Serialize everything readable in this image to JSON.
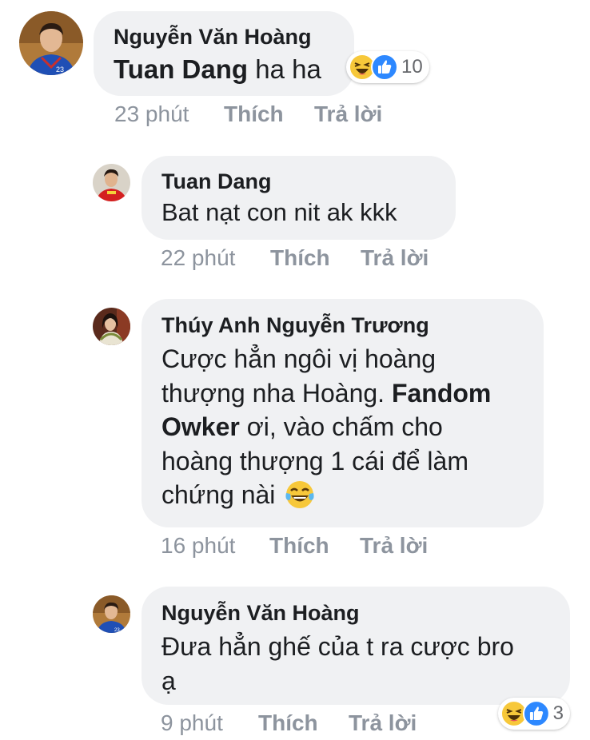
{
  "comments": [
    {
      "author": "Nguyễn Văn Hoàng",
      "mention": "Tuan Dang",
      "text": " ha ha",
      "time": "23 phút",
      "like_label": "Thích",
      "reply_label": "Trả lời",
      "reactions": {
        "icons": [
          "haha-icon",
          "like-icon"
        ],
        "count": "10"
      }
    },
    {
      "author": "Tuan Dang",
      "text": "Bat nạt con nit ak kkk",
      "time": "22 phút",
      "like_label": "Thích",
      "reply_label": "Trả lời"
    },
    {
      "author": "Thúy Anh Nguyễn Trương",
      "lines": [
        "Cược hẳn ngôi vị hoàng",
        "thượng nha Hoàng. ",
        "Fandom",
        "Owker",
        " ơi, vào chấm cho",
        "hoàng thượng 1 cái để làm",
        "chứng nài "
      ],
      "emoji": "laughing-tears-icon",
      "time": "16 phút",
      "like_label": "Thích",
      "reply_label": "Trả lời"
    },
    {
      "author": "Nguyễn Văn Hoàng",
      "lines": [
        "Đưa hẳn ghế của t ra cược bro",
        "ạ"
      ],
      "time": "9 phút",
      "like_label": "Thích",
      "reply_label": "Trả lời",
      "reactions": {
        "icons": [
          "haha-icon",
          "like-icon"
        ],
        "count": "3"
      }
    }
  ],
  "colors": {
    "bubble": "#f0f1f3",
    "meta": "#8d949e",
    "like_blue": "#2d88ff",
    "haha_yellow": "#f7c83a"
  }
}
